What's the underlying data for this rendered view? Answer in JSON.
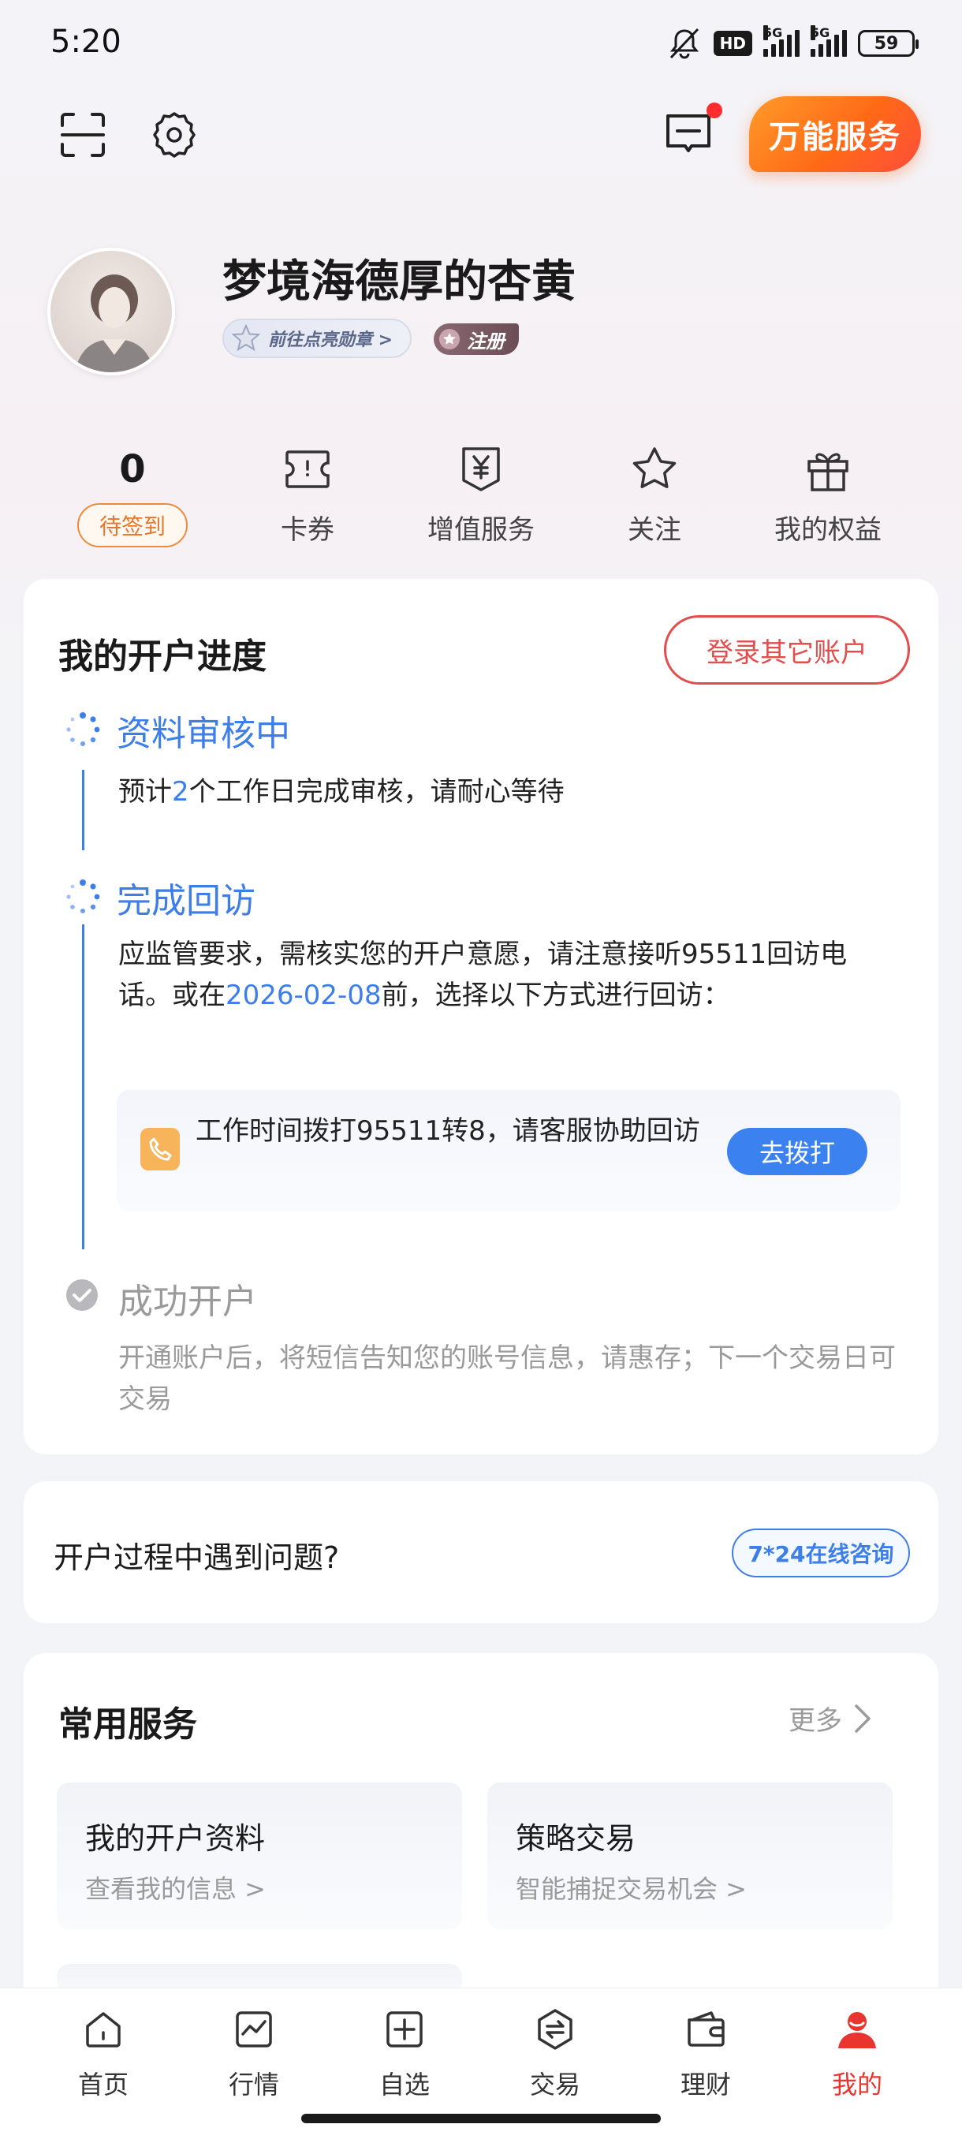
{
  "status_bar": {
    "time": "5:20",
    "hd_label": "HD",
    "network_1": "5G",
    "network_2": "5G",
    "battery": "59"
  },
  "header": {
    "scan_icon": "scan-icon",
    "settings_icon": "gear-icon",
    "message_icon": "message-icon",
    "super_service_label": "万能服务"
  },
  "profile": {
    "username": "梦境海德厚的杏黄",
    "medal_label": "前往点亮勋章 >",
    "register_label": "注册"
  },
  "stats": [
    {
      "value": "0",
      "label": "待签到"
    },
    {
      "label": "卡券",
      "icon": "ticket-icon"
    },
    {
      "label": "增值服务",
      "icon": "yen-icon"
    },
    {
      "label": "关注",
      "icon": "star-icon"
    },
    {
      "label": "我的权益",
      "icon": "gift-icon"
    }
  ],
  "progress": {
    "title": "我的开户进度",
    "login_other": "登录其它账户",
    "step1": {
      "title": "资料审核中",
      "text_a": "预计",
      "text_num": "2",
      "text_b": "个工作日完成审核，请耐心等待"
    },
    "step2": {
      "title": "完成回访",
      "text_a": "应监管要求，需核实您的开户意愿，请注意接听95511回访电话。或在",
      "text_date": "2026-02-08",
      "text_b": "前，选择以下方式进行回访："
    },
    "call": {
      "text": "工作时间拨打95511转8，请客服协助回访",
      "button": "去拨打"
    },
    "step3": {
      "title": "成功开户",
      "text": "开通账户后，将短信告知您的账号信息，请惠存；下一个交易日可交易"
    }
  },
  "help": {
    "text": "开户过程中遇到问题?",
    "button": "7*24在线咨询"
  },
  "services": {
    "title": "常用服务",
    "more": "更多",
    "tiles": [
      {
        "title": "我的开户资料",
        "sub": "查看我的信息 >"
      },
      {
        "title": "策略交易",
        "sub": "智能捕捉交易机会 >"
      }
    ]
  },
  "bottom_nav": [
    {
      "label": "首页",
      "icon": "home-icon"
    },
    {
      "label": "行情",
      "icon": "chart-icon"
    },
    {
      "label": "自选",
      "icon": "add-square-icon"
    },
    {
      "label": "交易",
      "icon": "exchange-icon"
    },
    {
      "label": "理财",
      "icon": "wallet-icon"
    },
    {
      "label": "我的",
      "icon": "user-icon",
      "active": true
    }
  ],
  "colors": {
    "accent_blue": "#3d7ee8",
    "accent_red": "#e24d4d",
    "accent_orange": "#ff6a17"
  }
}
